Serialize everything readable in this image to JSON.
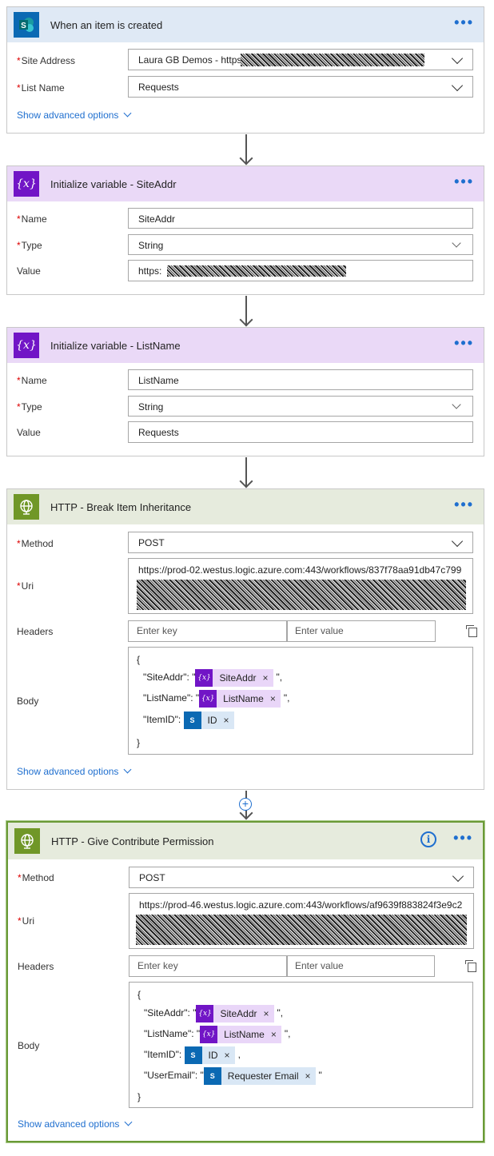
{
  "card1": {
    "title": "When an item is created",
    "site_label": "Site Address",
    "site_value": "Laura GB Demos - https:",
    "list_label": "List Name",
    "list_value": "Requests",
    "advanced": "Show advanced options"
  },
  "card2": {
    "title": "Initialize variable - SiteAddr",
    "name_label": "Name",
    "name_value": "SiteAddr",
    "type_label": "Type",
    "type_value": "String",
    "value_label": "Value",
    "value_value": "https:"
  },
  "card3": {
    "title": "Initialize variable - ListName",
    "name_label": "Name",
    "name_value": "ListName",
    "type_label": "Type",
    "type_value": "String",
    "value_label": "Value",
    "value_value": "Requests"
  },
  "card4": {
    "title": "HTTP - Break Item Inheritance",
    "method_label": "Method",
    "method_value": "POST",
    "uri_label": "Uri",
    "uri_value": "https://prod-02.westus.logic.azure.com:443/workflows/837f78aa91db47c799",
    "headers_label": "Headers",
    "key_placeholder": "Enter key",
    "value_placeholder": "Enter value",
    "body_label": "Body",
    "body": {
      "open": "{",
      "close": "}",
      "line1_key": "\"SiteAddr\": \"",
      "line1_token": "SiteAddr",
      "line1_end": "\",",
      "line2_key": "\"ListName\": \"",
      "line2_token": "ListName",
      "line2_end": "\",",
      "line3_key": "\"ItemID\":",
      "line3_token": "ID"
    },
    "advanced": "Show advanced options"
  },
  "card5": {
    "title": "HTTP - Give Contribute Permission",
    "method_label": "Method",
    "method_value": "POST",
    "uri_label": "Uri",
    "uri_value": "https://prod-46.westus.logic.azure.com:443/workflows/af9639f883824f3e9c2",
    "headers_label": "Headers",
    "key_placeholder": "Enter key",
    "value_placeholder": "Enter value",
    "body_label": "Body",
    "body": {
      "open": "{",
      "close": "}",
      "line1_key": "\"SiteAddr\": \"",
      "line1_token": "SiteAddr",
      "line1_end": "\",",
      "line2_key": "\"ListName\": \"",
      "line2_token": "ListName",
      "line2_end": "\",",
      "line3_key": "\"ItemID\":",
      "line3_token": "ID",
      "line3_end": ",",
      "line4_key": "\"UserEmail\": \"",
      "line4_token": "Requester Email",
      "line4_end": "\""
    },
    "advanced": "Show advanced options"
  },
  "icons": {
    "sharepoint": "sharepoint-icon",
    "variable": "variable-icon",
    "http": "globe-icon",
    "more": "more-dots-icon",
    "info": "info-icon",
    "copy": "copy-icon",
    "insert": "plus-icon",
    "remove": "remove-x-icon"
  },
  "symbols": {
    "dots": "•••",
    "info": "i",
    "plus": "+",
    "remove": "×",
    "variable_glyph": "{x}",
    "sharepoint_glyph": "S"
  },
  "colors": {
    "sharepoint_header": "#dfe9f5",
    "variable_header": "#ead9f7",
    "http_header": "#e6ebdd",
    "sharepoint_icon": "#0b69b3",
    "variable_icon": "#7115c6",
    "http_icon": "#709727",
    "link": "#1f6fcf",
    "selected_border": "#6a9a36"
  }
}
